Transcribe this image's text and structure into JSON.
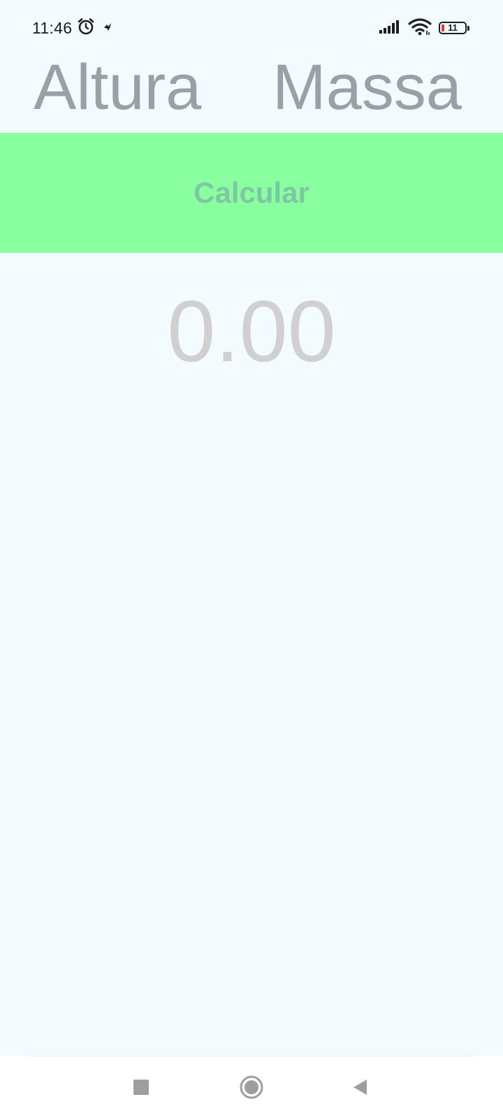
{
  "status_bar": {
    "time": "11:46",
    "battery_level": "11",
    "icons": [
      "alarm-icon",
      "notification-icon",
      "signal-icon",
      "wifi-icon",
      "battery-icon"
    ]
  },
  "form": {
    "height_placeholder": "Altura",
    "mass_placeholder": "Massa",
    "calculate_label": "Calcular",
    "result_value": "0.00"
  },
  "navigation": {
    "buttons": [
      "recents-icon",
      "home-icon",
      "back-icon"
    ]
  },
  "colors": {
    "background": "#f3fbff",
    "button_background": "#8aff9f",
    "button_text": "#7cc8a4",
    "placeholder_text": "#9aa0a6",
    "result_text": "#d0d0d0"
  }
}
